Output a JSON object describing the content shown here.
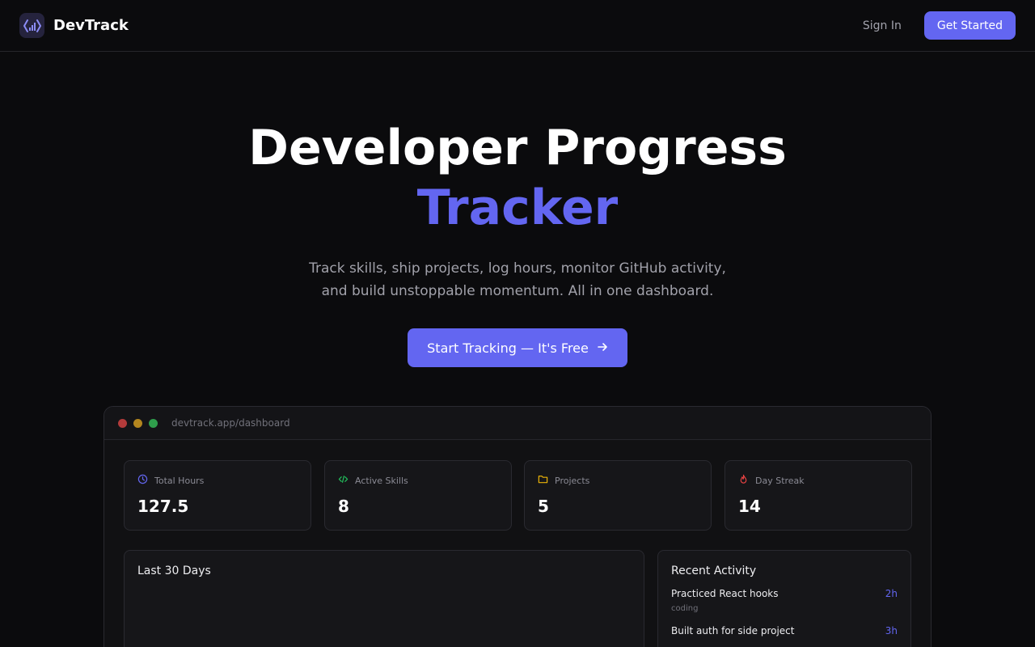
{
  "header": {
    "brand": "DevTrack",
    "sign_in": "Sign In",
    "get_started": "Get Started"
  },
  "hero": {
    "title_line1": "Developer Progress",
    "title_line2": "Tracker",
    "subtitle_line1": "Track skills, ship projects, log hours, monitor GitHub activity,",
    "subtitle_line2": "and build unstoppable momentum. All in one dashboard.",
    "cta": "Start Tracking — It's Free"
  },
  "preview": {
    "url": "devtrack.app/dashboard",
    "stats": [
      {
        "label": "Total Hours",
        "value": "127.5",
        "icon": "clock-icon",
        "color": "#6366f1"
      },
      {
        "label": "Active Skills",
        "value": "8",
        "icon": "code-icon",
        "color": "#22c55e"
      },
      {
        "label": "Projects",
        "value": "5",
        "icon": "folder-icon",
        "color": "#eab308"
      },
      {
        "label": "Day Streak",
        "value": "14",
        "icon": "flame-icon",
        "color": "#ef4444"
      }
    ],
    "chart_title": "Last 30 Days",
    "activity_title": "Recent Activity",
    "activity": [
      {
        "title": "Practiced React hooks",
        "category": "coding",
        "time": "2h"
      },
      {
        "title": "Built auth for side project",
        "category": "",
        "time": "3h"
      }
    ]
  },
  "colors": {
    "accent": "#6366f1",
    "background": "#0b0b0d",
    "window_dots": [
      "#ef4444",
      "#eab308",
      "#22c55e"
    ]
  }
}
